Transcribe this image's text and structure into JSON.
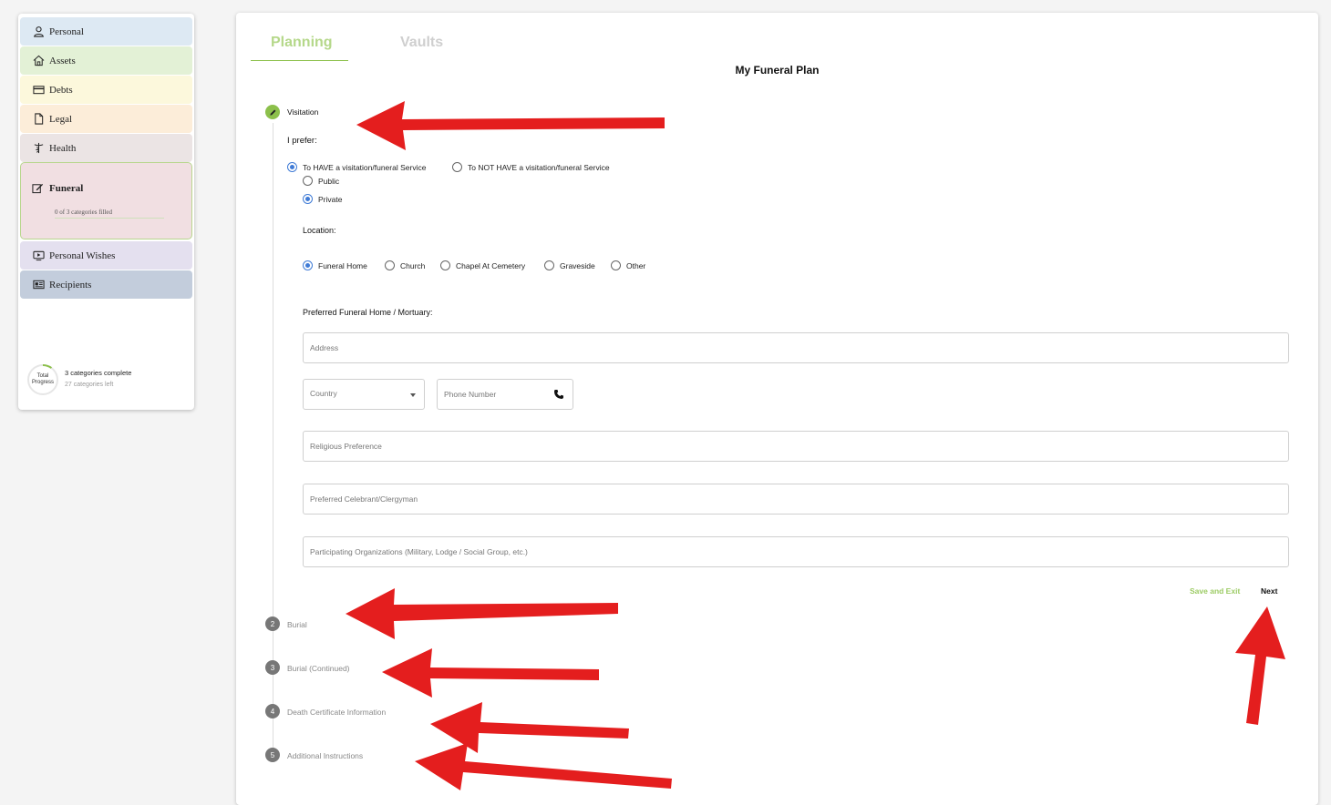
{
  "sidebar": {
    "items": [
      {
        "label": "Personal",
        "icon": "user-icon",
        "bg": "#dde9f3"
      },
      {
        "label": "Assets",
        "icon": "home-icon",
        "bg": "#e3f1d6"
      },
      {
        "label": "Debts",
        "icon": "credit-card-icon",
        "bg": "#fcf8dc"
      },
      {
        "label": "Legal",
        "icon": "document-icon",
        "bg": "#fcedd9"
      },
      {
        "label": "Health",
        "icon": "caduceus-icon",
        "bg": "#ebe4e4"
      },
      {
        "label": "Funeral",
        "icon": "edit-icon",
        "bg": "#f1dfe2",
        "subtitle": "0 of 3 categories filled"
      },
      {
        "label": "Personal Wishes",
        "icon": "video-icon",
        "bg": "#e4e0ef"
      },
      {
        "label": "Recipients",
        "icon": "id-card-icon",
        "bg": "#c3cddc"
      }
    ],
    "progress": {
      "label": "Total Progress",
      "complete_text": "3 categories complete",
      "left_text": "27 categories left",
      "fraction": 0.1,
      "color": "#8cc04b"
    }
  },
  "tabs": [
    {
      "label": "Planning",
      "active": true
    },
    {
      "label": "Vaults",
      "active": false
    }
  ],
  "page_title": "My Funeral Plan",
  "steps": [
    {
      "number": "",
      "label": "Visitation",
      "active": true,
      "icon": "pencil-icon"
    },
    {
      "number": "2",
      "label": "Burial",
      "active": false
    },
    {
      "number": "3",
      "label": "Burial (Continued)",
      "active": false
    },
    {
      "number": "4",
      "label": "Death Certificate Information",
      "active": false
    },
    {
      "number": "5",
      "label": "Additional Instructions",
      "active": false
    }
  ],
  "form": {
    "prefer_label": "I prefer:",
    "service_options": [
      {
        "label": "To HAVE a visitation/funeral Service",
        "selected": true
      },
      {
        "label": "To NOT HAVE a visitation/funeral Service",
        "selected": false
      }
    ],
    "privacy_options": [
      {
        "label": "Public",
        "selected": false
      },
      {
        "label": "Private",
        "selected": true
      }
    ],
    "location_label": "Location:",
    "location_options": [
      {
        "label": "Funeral Home",
        "selected": true
      },
      {
        "label": "Church",
        "selected": false
      },
      {
        "label": "Chapel At Cemetery",
        "selected": false
      },
      {
        "label": "Graveside",
        "selected": false
      },
      {
        "label": "Other",
        "selected": false
      }
    ],
    "funeral_home_label": "Preferred Funeral Home / Mortuary:",
    "address_placeholder": "Address",
    "country_placeholder": "Country",
    "phone_placeholder": "Phone Number",
    "religious_placeholder": "Religious Preference",
    "celebrant_placeholder": "Preferred Celebrant/Clergyman",
    "organizations_placeholder": "Participating Organizations (Military, Lodge / Social Group, etc.)"
  },
  "actions": {
    "save_label": "Save and Exit",
    "next_label": "Next"
  },
  "colors": {
    "accent_green": "#8cc04b",
    "radio_blue": "#3f7bd6",
    "annotation_red": "#e41e1e"
  }
}
